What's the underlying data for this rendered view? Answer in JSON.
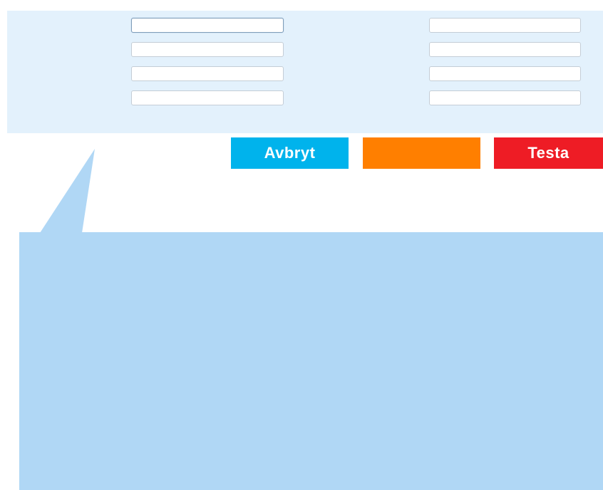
{
  "form": {
    "left_fields": [
      {
        "value": "",
        "placeholder": ""
      },
      {
        "value": "",
        "placeholder": ""
      },
      {
        "value": "",
        "placeholder": ""
      },
      {
        "value": "",
        "placeholder": ""
      }
    ],
    "right_fields": [
      {
        "value": "",
        "placeholder": ""
      },
      {
        "value": "",
        "placeholder": ""
      },
      {
        "value": "",
        "placeholder": ""
      },
      {
        "value": "",
        "placeholder": ""
      }
    ]
  },
  "buttons": {
    "cancel_label": "Avbryt",
    "middle_label": "",
    "test_label": "Testa"
  },
  "colors": {
    "panel_background": "#e3f1fc",
    "cancel_button": "#00b3ec",
    "middle_button": "#ff7f00",
    "test_button": "#ee1c25",
    "bubble": "#b0d7f5"
  }
}
